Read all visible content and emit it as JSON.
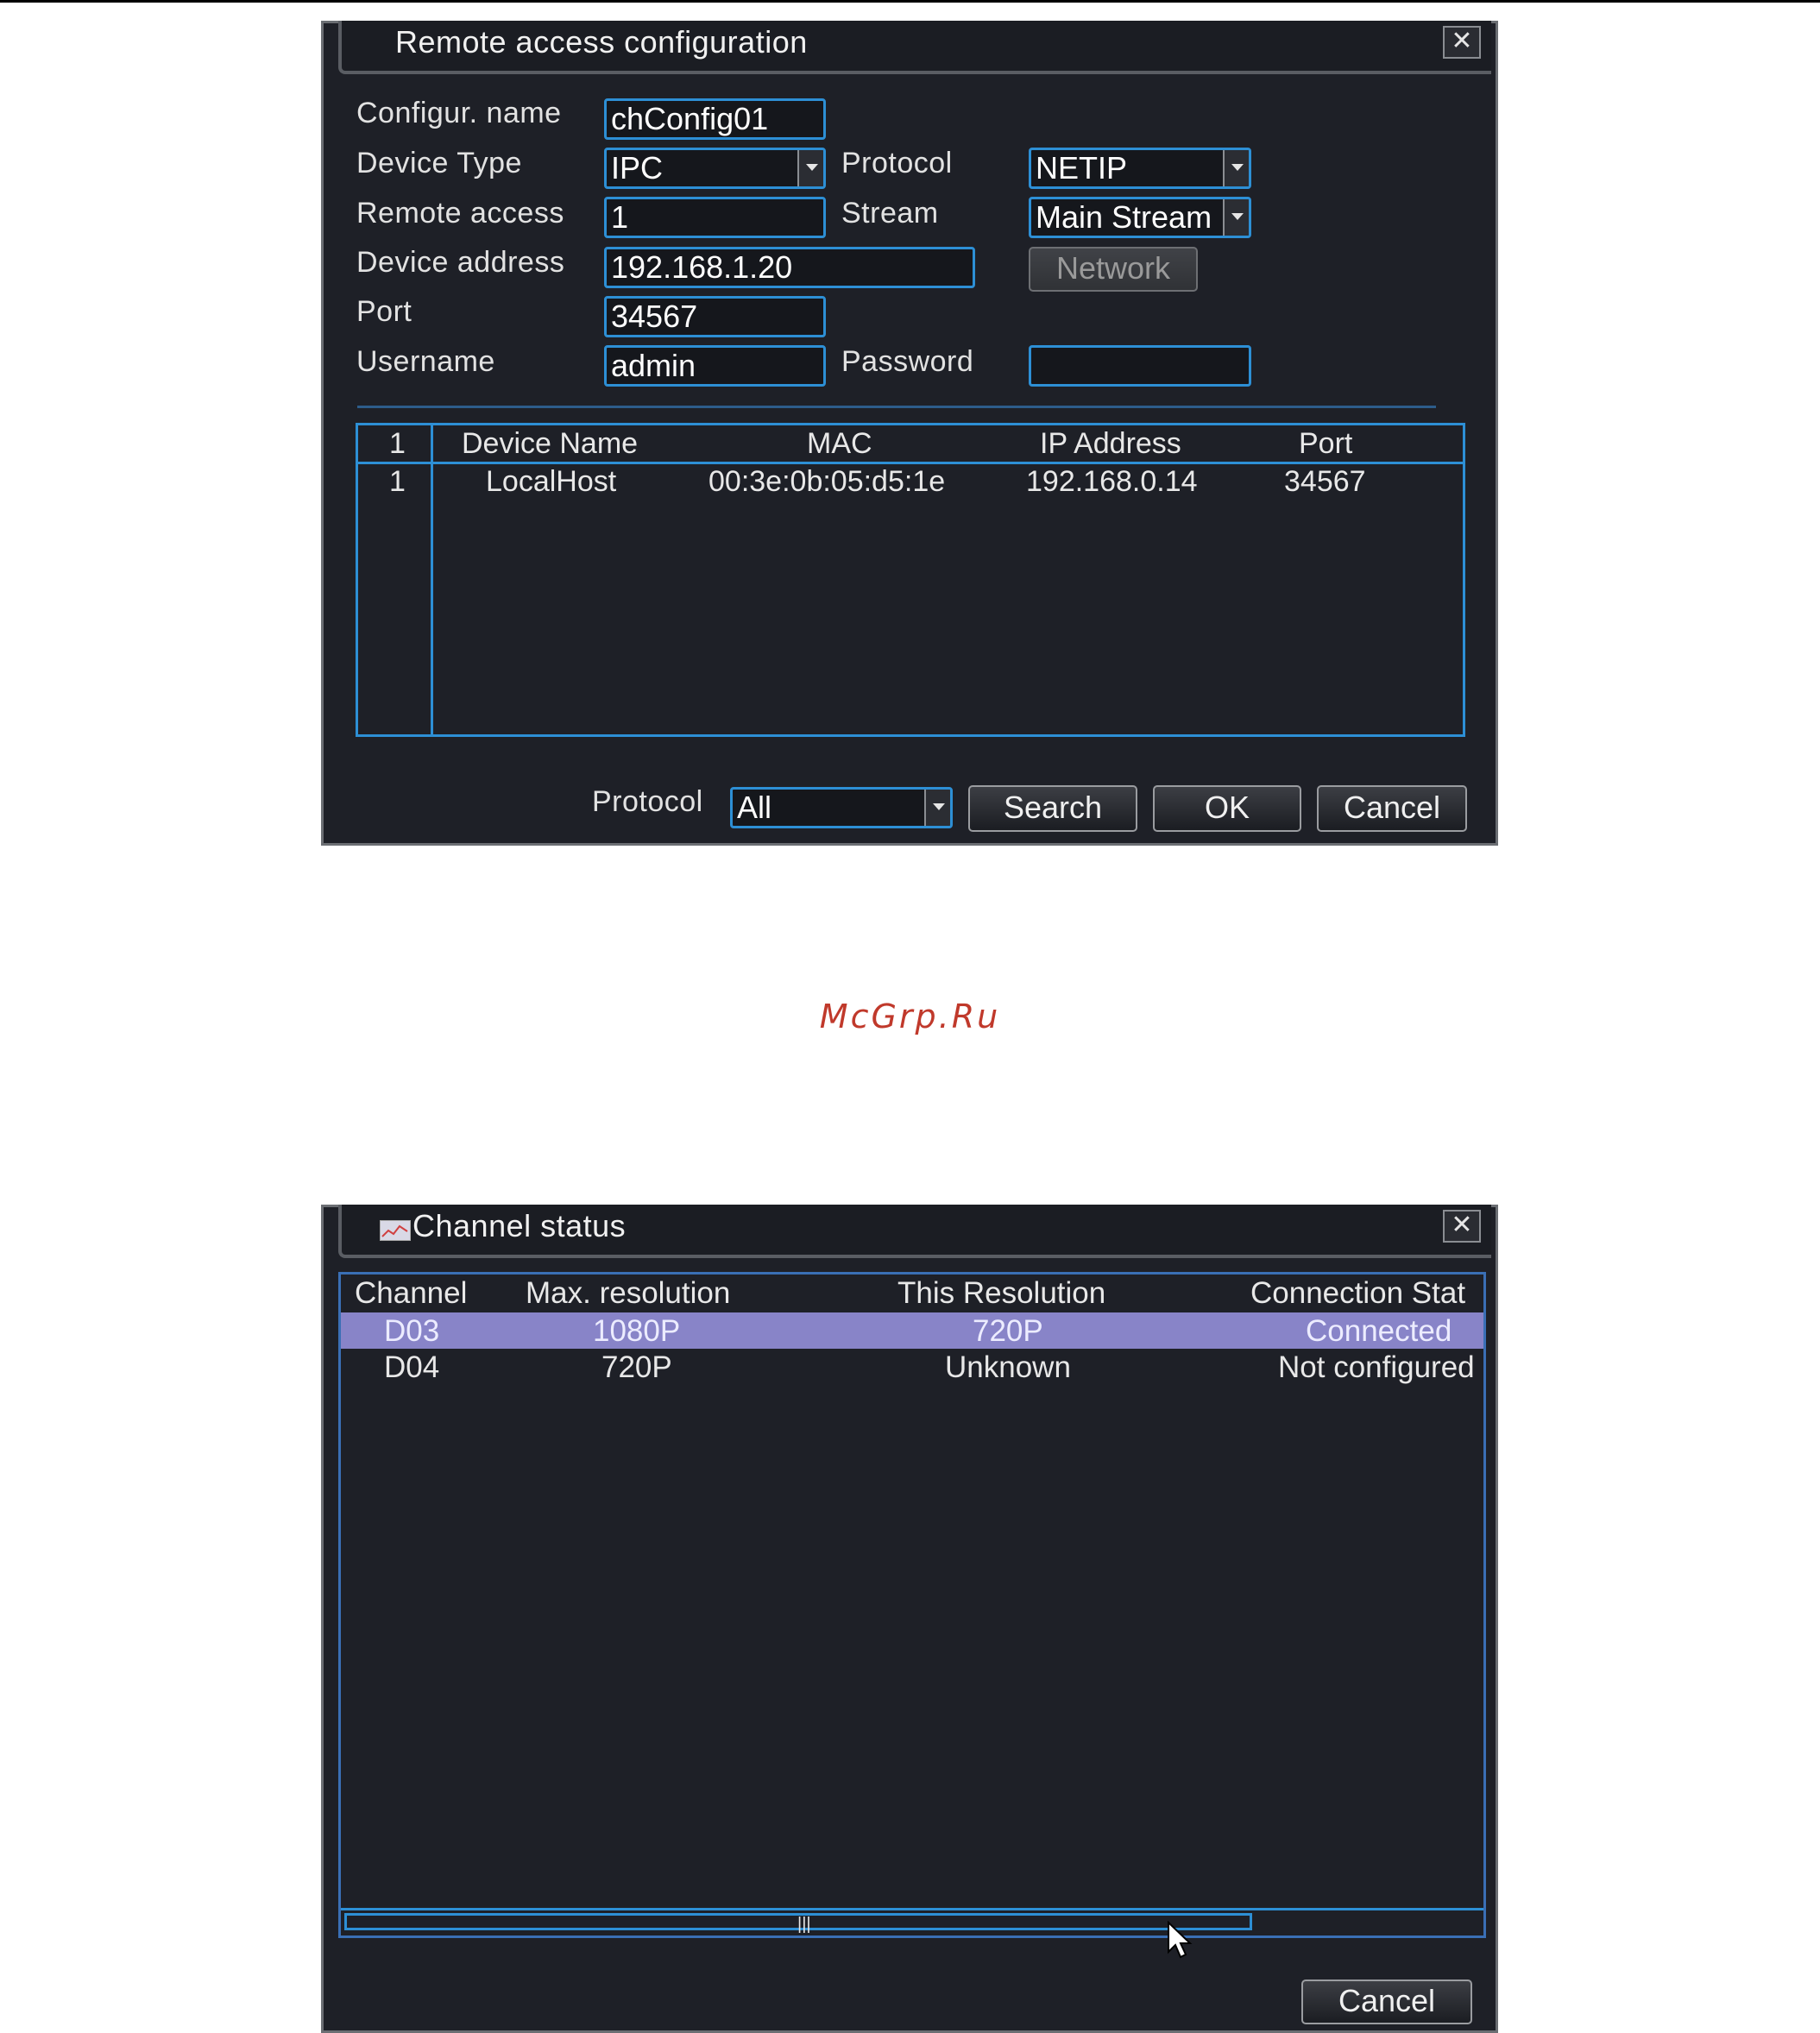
{
  "watermark": "McGrp.Ru",
  "remote_dialog": {
    "title": "Remote access configuration",
    "close_glyph": "✕",
    "fields": {
      "config_name": {
        "label": "Configur. name",
        "value": "chConfig01"
      },
      "device_type": {
        "label": "Device Type",
        "value": "IPC"
      },
      "protocol": {
        "label": "Protocol",
        "value": "NETIP"
      },
      "remote_access": {
        "label": "Remote access",
        "value": "1"
      },
      "stream": {
        "label": "Stream",
        "value": "Main Stream"
      },
      "device_address": {
        "label": "Device address",
        "value": "192.168.1.20"
      },
      "port": {
        "label": "Port",
        "value": "34567"
      },
      "username": {
        "label": "Username",
        "value": "admin"
      },
      "password": {
        "label": "Password",
        "value": ""
      }
    },
    "network_button": "Network",
    "table": {
      "headers": [
        "1",
        "Device Name",
        "MAC",
        "IP Address",
        "Port"
      ],
      "rows": [
        [
          "1",
          "LocalHost",
          "00:3e:0b:05:d5:1e",
          "192.168.0.14",
          "34567"
        ]
      ]
    },
    "footer": {
      "protocol_label": "Protocol",
      "protocol_value": "All",
      "search": "Search",
      "ok": "OK",
      "cancel": "Cancel"
    }
  },
  "channel_dialog": {
    "title": "Channel status",
    "close_glyph": "✕",
    "headers": [
      "Channel",
      "Max. resolution",
      "This Resolution",
      "Connection Stat"
    ],
    "rows": [
      {
        "channel": "D03",
        "max": "1080P",
        "this": "720P",
        "status": "Connected"
      },
      {
        "channel": "D04",
        "max": "720P",
        "this": "Unknown",
        "status": "Not configured"
      }
    ],
    "scroll_grip": "|||",
    "cancel": "Cancel"
  }
}
